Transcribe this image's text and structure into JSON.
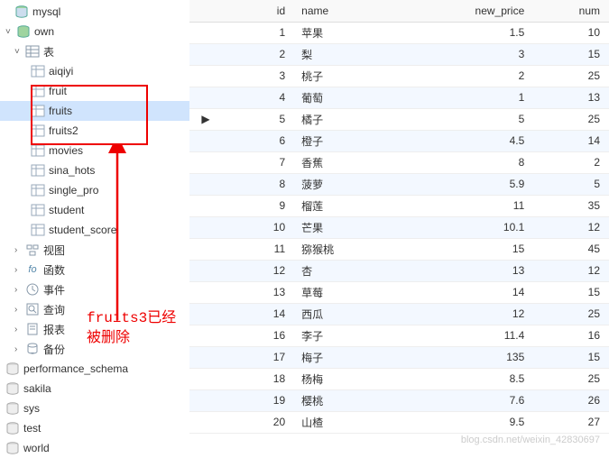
{
  "tree": {
    "mysql": "mysql",
    "own": "own",
    "tables_label": "表",
    "tables": [
      "aiqiyi",
      "fruit",
      "fruits",
      "fruits2",
      "movies",
      "sina_hots",
      "single_pro",
      "student",
      "student_score"
    ],
    "views": "视图",
    "functions": "函数",
    "events": "事件",
    "queries": "查询",
    "reports": "报表",
    "backup": "备份",
    "other_dbs": [
      "performance_schema",
      "sakila",
      "sys",
      "test",
      "world"
    ]
  },
  "columns": {
    "id": "id",
    "name": "name",
    "new_price": "new_price",
    "num": "num"
  },
  "rows": [
    {
      "id": 1,
      "name": "苹果",
      "new_price": "1.5",
      "num": 10
    },
    {
      "id": 2,
      "name": "梨",
      "new_price": "3",
      "num": 15
    },
    {
      "id": 3,
      "name": "桃子",
      "new_price": "2",
      "num": 25
    },
    {
      "id": 4,
      "name": "葡萄",
      "new_price": "1",
      "num": 13
    },
    {
      "id": 5,
      "name": "橘子",
      "new_price": "5",
      "num": 25
    },
    {
      "id": 6,
      "name": "橙子",
      "new_price": "4.5",
      "num": 14
    },
    {
      "id": 7,
      "name": "香蕉",
      "new_price": "8",
      "num": 2
    },
    {
      "id": 8,
      "name": "菠萝",
      "new_price": "5.9",
      "num": 5
    },
    {
      "id": 9,
      "name": "榴莲",
      "new_price": "11",
      "num": 35
    },
    {
      "id": 10,
      "name": "芒果",
      "new_price": "10.1",
      "num": 12
    },
    {
      "id": 11,
      "name": "猕猴桃",
      "new_price": "15",
      "num": 45
    },
    {
      "id": 12,
      "name": "杏",
      "new_price": "13",
      "num": 12
    },
    {
      "id": 13,
      "name": "草莓",
      "new_price": "14",
      "num": 15
    },
    {
      "id": 14,
      "name": "西瓜",
      "new_price": "12",
      "num": 25
    },
    {
      "id": 16,
      "name": "李子",
      "new_price": "11.4",
      "num": 16
    },
    {
      "id": 17,
      "name": "梅子",
      "new_price": "135",
      "num": 15
    },
    {
      "id": 18,
      "name": "杨梅",
      "new_price": "8.5",
      "num": 25
    },
    {
      "id": 19,
      "name": "樱桃",
      "new_price": "7.6",
      "num": 26
    },
    {
      "id": 20,
      "name": "山楂",
      "new_price": "9.5",
      "num": 27
    }
  ],
  "current_row_index": 4,
  "annotation": {
    "line1": "fruits3已经",
    "line2": "被删除"
  },
  "watermark": "blog.csdn.net/weixin_42830697"
}
